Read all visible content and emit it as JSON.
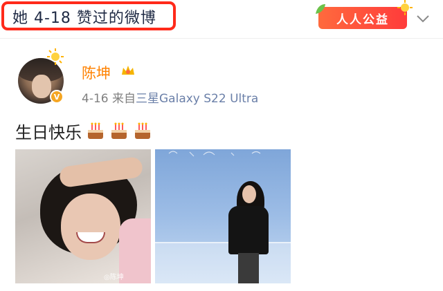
{
  "header": {
    "title": "她 4-18 赞过的微博",
    "charity_label": "人人公益",
    "icons": {
      "expand": "chevron-down-icon",
      "charity_leaf": "leaf-icon",
      "charity_sun": "sun-icon"
    },
    "colors": {
      "highlight_border": "#ff2a1a",
      "charity_bg": "#ff4a3a"
    }
  },
  "post": {
    "username": "陈坤",
    "badges": {
      "crown": "crown-icon",
      "verified": "V",
      "avatar_sun": "sun-icon"
    },
    "date": "4-16",
    "source_prefix": "来自",
    "source_device": "三星Galaxy S22 Ultra",
    "text": "生日快乐",
    "emoji_count_label": "cake-icon",
    "photos": [
      {
        "name": "photo-1",
        "watermark": "◎陈坤"
      },
      {
        "name": "photo-2"
      }
    ],
    "colors": {
      "username": "#ff8200",
      "meta": "#808080"
    }
  }
}
